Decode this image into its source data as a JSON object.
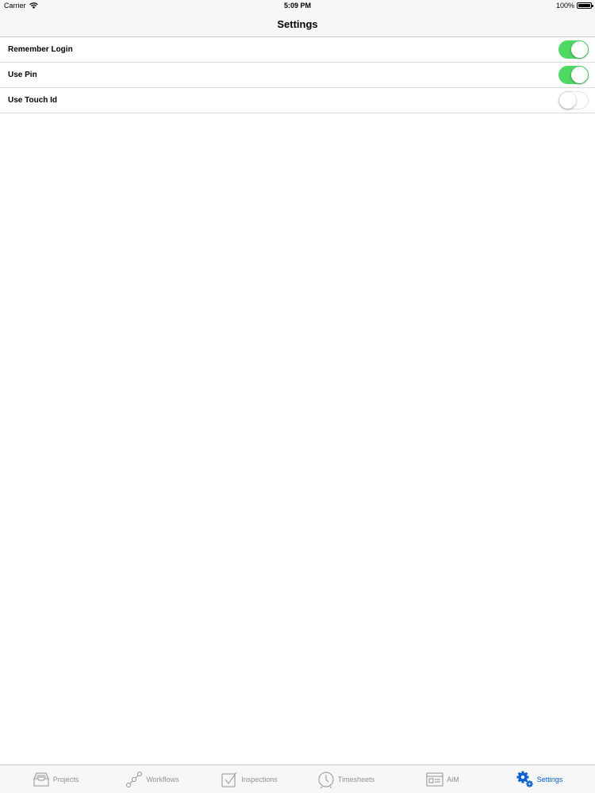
{
  "status_bar": {
    "carrier": "Carrier",
    "time": "5:09 PM",
    "battery": "100%"
  },
  "nav": {
    "title": "Settings"
  },
  "settings": [
    {
      "label": "Remember Login",
      "enabled": true
    },
    {
      "label": "Use Pin",
      "enabled": true
    },
    {
      "label": "Use Touch Id",
      "enabled": false
    }
  ],
  "tabs": [
    {
      "label": "Projects",
      "icon": "projects-icon",
      "active": false
    },
    {
      "label": "Workflows",
      "icon": "workflows-icon",
      "active": false
    },
    {
      "label": "Inspections",
      "icon": "inspections-icon",
      "active": false
    },
    {
      "label": "Timesheets",
      "icon": "timesheets-icon",
      "active": false
    },
    {
      "label": "AiM",
      "icon": "aim-icon",
      "active": false
    },
    {
      "label": "Settings",
      "icon": "gear-icon",
      "active": true
    }
  ],
  "colors": {
    "toggle_on": "#4cd964",
    "tab_active": "#0a60d6",
    "tab_inactive": "#929292"
  }
}
